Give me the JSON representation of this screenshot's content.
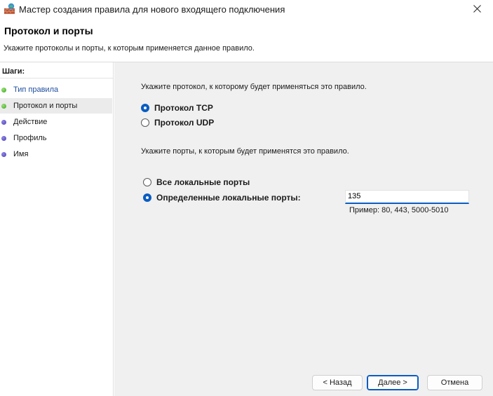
{
  "window": {
    "title": "Мастер создания правила для нового входящего подключения"
  },
  "header": {
    "title": "Протокол и порты",
    "subtitle": "Укажите протоколы и порты, к которым применяется данное правило."
  },
  "sidebar": {
    "label": "Шаги:",
    "steps": [
      {
        "label": "Тип правила",
        "state": "done"
      },
      {
        "label": "Протокол и порты",
        "state": "current"
      },
      {
        "label": "Действие",
        "state": "pending"
      },
      {
        "label": "Профиль",
        "state": "pending"
      },
      {
        "label": "Имя",
        "state": "pending"
      }
    ]
  },
  "main": {
    "protocol_prompt": "Укажите протокол, к которому будет применяться это правило.",
    "protocol_options": [
      {
        "label": "Протокол TCP",
        "checked": true
      },
      {
        "label": "Протокол UDP",
        "checked": false
      }
    ],
    "ports_prompt": "Укажите порты, к которым будет применятся это правило.",
    "port_options": [
      {
        "label": "Все локальные порты",
        "checked": false
      },
      {
        "label": "Определенные локальные порты:",
        "checked": true
      }
    ],
    "ports_value": "135",
    "ports_example": "Пример: 80, 443, 5000-5010"
  },
  "buttons": {
    "back": "< Назад",
    "next": "Далее >",
    "cancel": "Отмена"
  },
  "colors": {
    "accent": "#0a5cc2",
    "content_bg": "#f0f0f0",
    "step_done": "#3aa61c",
    "step_pending": "#4b3db2",
    "link": "#1f4e9e"
  }
}
